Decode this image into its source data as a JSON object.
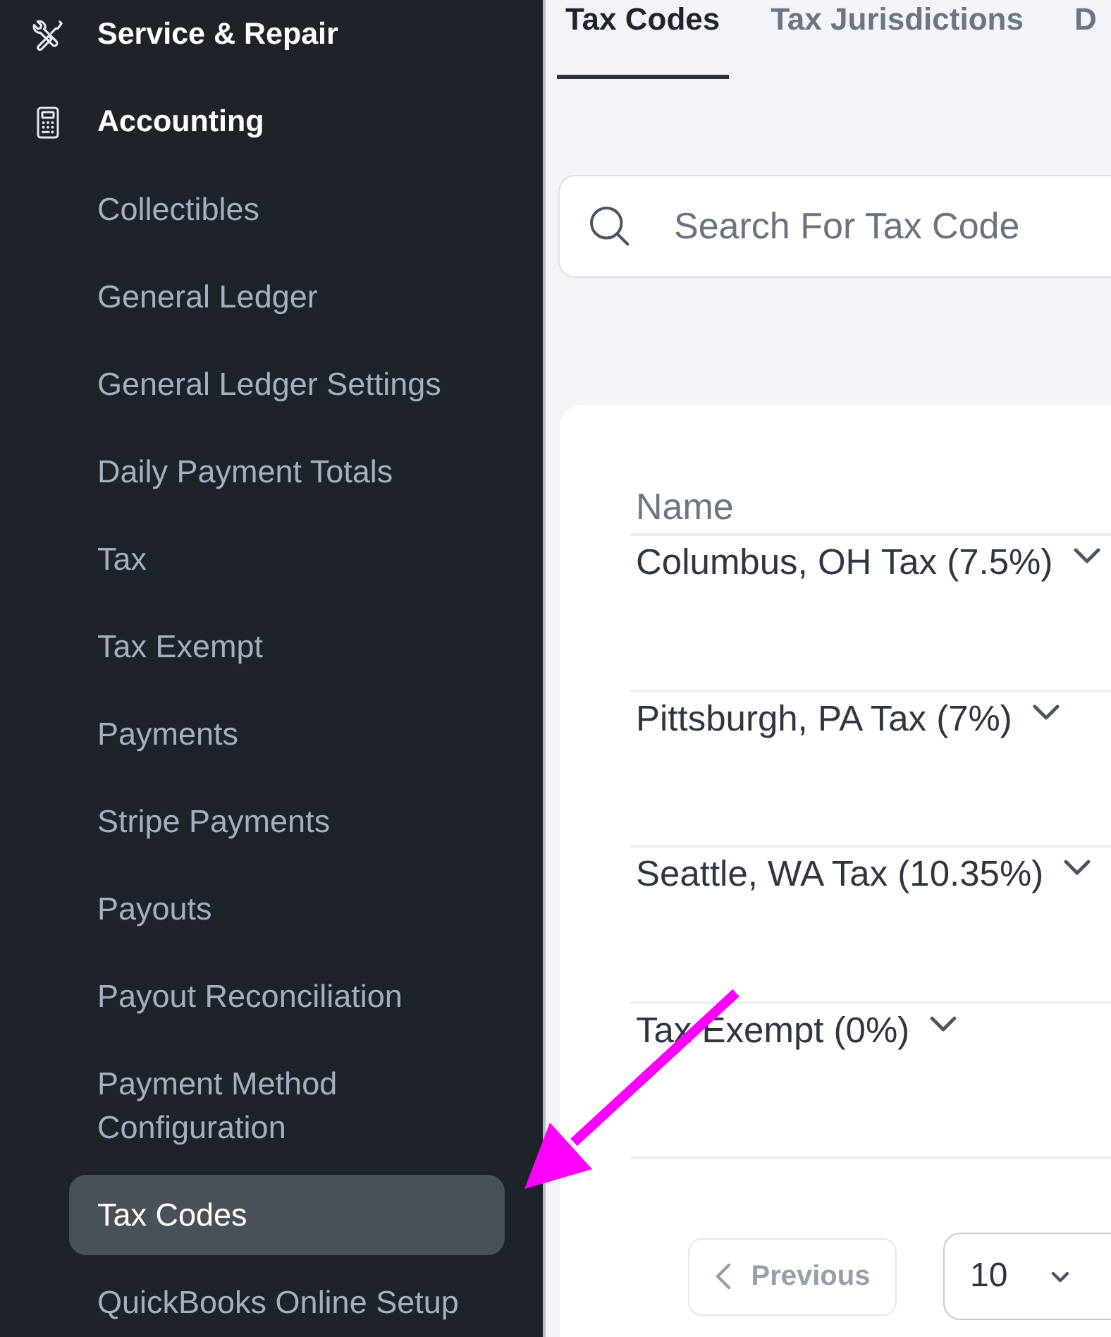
{
  "sidebar": {
    "items": [
      {
        "label": "Service & Repair",
        "selected": false
      },
      {
        "label": "Accounting",
        "selected": false,
        "children": [
          {
            "label": "Collectibles",
            "selected": false
          },
          {
            "label": "General Ledger",
            "selected": false
          },
          {
            "label": "General Ledger Settings",
            "selected": false
          },
          {
            "label": "Daily Payment Totals",
            "selected": false
          },
          {
            "label": "Tax",
            "selected": false
          },
          {
            "label": "Tax Exempt",
            "selected": false
          },
          {
            "label": "Payments",
            "selected": false
          },
          {
            "label": "Stripe Payments",
            "selected": false
          },
          {
            "label": "Payouts",
            "selected": false
          },
          {
            "label": "Payout Reconciliation",
            "selected": false
          },
          {
            "label": "Payment Method Configuration",
            "selected": false
          },
          {
            "label": "Tax Codes",
            "selected": true
          },
          {
            "label": "QuickBooks Online Setup",
            "selected": false
          }
        ]
      }
    ]
  },
  "tabs": [
    {
      "label": "Tax Codes",
      "selected": true
    },
    {
      "label": "Tax Jurisdictions",
      "selected": false
    },
    {
      "label": "D",
      "selected": false
    }
  ],
  "search": {
    "placeholder": "Search For Tax Code"
  },
  "table": {
    "columns": [
      "Name"
    ],
    "rows": [
      {
        "name": "Columbus, OH Tax (7.5%)",
        "expanded": false
      },
      {
        "name": "Pittsburgh, PA Tax (7%)",
        "expanded": false
      },
      {
        "name": "Seattle, WA Tax (10.35%)",
        "expanded": false
      },
      {
        "name": "Tax Exempt (0%)",
        "expanded": false
      }
    ]
  },
  "pagination": {
    "previous": {
      "label": "Previous",
      "disabled": true
    },
    "page_size": {
      "value": "10"
    }
  },
  "annotations": [
    {
      "kind": "arrow"
    }
  ]
}
